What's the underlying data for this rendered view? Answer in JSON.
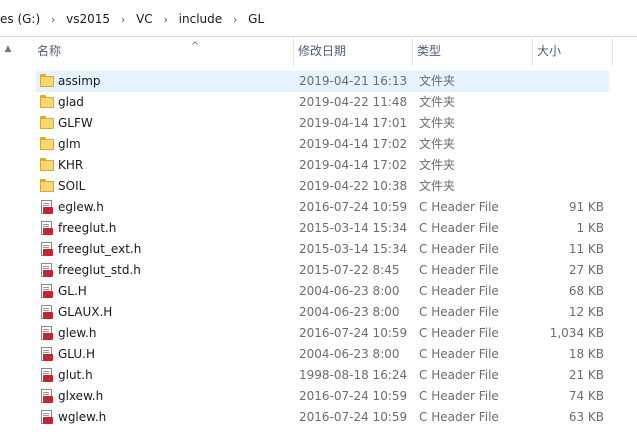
{
  "address_bar": {
    "crumbs": [
      "es (G:)",
      "vs2015",
      "VC",
      "include",
      "GL"
    ],
    "separator": "›"
  },
  "columns": {
    "name": "名称",
    "date": "修改日期",
    "type": "类型",
    "size": "大小",
    "sort_arrow": "^"
  },
  "files": [
    {
      "name": "assimp",
      "date": "2019-04-21 16:13",
      "type": "文件夹",
      "size": "",
      "kind": "folder-icon",
      "selected": true
    },
    {
      "name": "glad",
      "date": "2019-04-22 11:48",
      "type": "文件夹",
      "size": "",
      "kind": "folder-icon"
    },
    {
      "name": "GLFW",
      "date": "2019-04-14 17:01",
      "type": "文件夹",
      "size": "",
      "kind": "folder-icon"
    },
    {
      "name": "glm",
      "date": "2019-04-14 17:02",
      "type": "文件夹",
      "size": "",
      "kind": "folder-icon"
    },
    {
      "name": "KHR",
      "date": "2019-04-14 17:02",
      "type": "文件夹",
      "size": "",
      "kind": "folder-icon"
    },
    {
      "name": "SOIL",
      "date": "2019-04-22 10:38",
      "type": "文件夹",
      "size": "",
      "kind": "folder-icon"
    },
    {
      "name": "eglew.h",
      "date": "2016-07-24 10:59",
      "type": "C Header File",
      "size": "91 KB",
      "kind": "header-file-icon"
    },
    {
      "name": "freeglut.h",
      "date": "2015-03-14 15:34",
      "type": "C Header File",
      "size": "1 KB",
      "kind": "header-file-icon"
    },
    {
      "name": "freeglut_ext.h",
      "date": "2015-03-14 15:34",
      "type": "C Header File",
      "size": "11 KB",
      "kind": "header-file-icon"
    },
    {
      "name": "freeglut_std.h",
      "date": "2015-07-22 8:45",
      "type": "C Header File",
      "size": "27 KB",
      "kind": "header-file-icon"
    },
    {
      "name": "GL.H",
      "date": "2004-06-23 8:00",
      "type": "C Header File",
      "size": "68 KB",
      "kind": "header-file-icon"
    },
    {
      "name": "GLAUX.H",
      "date": "2004-06-23 8:00",
      "type": "C Header File",
      "size": "12 KB",
      "kind": "header-file-icon"
    },
    {
      "name": "glew.h",
      "date": "2016-07-24 10:59",
      "type": "C Header File",
      "size": "1,034 KB",
      "kind": "header-file-icon"
    },
    {
      "name": "GLU.H",
      "date": "2004-06-23 8:00",
      "type": "C Header File",
      "size": "18 KB",
      "kind": "header-file-icon"
    },
    {
      "name": "glut.h",
      "date": "1998-08-18 16:24",
      "type": "C Header File",
      "size": "21 KB",
      "kind": "header-file-icon"
    },
    {
      "name": "glxew.h",
      "date": "2016-07-24 10:59",
      "type": "C Header File",
      "size": "74 KB",
      "kind": "header-file-icon"
    },
    {
      "name": "wglew.h",
      "date": "2016-07-24 10:59",
      "type": "C Header File",
      "size": "63 KB",
      "kind": "header-file-icon"
    }
  ],
  "colors": {
    "selected_row": "#e5f3ff",
    "header_text": "#4c607a",
    "folder": "#f8d775",
    "header_file_badge": "#c4262e"
  }
}
